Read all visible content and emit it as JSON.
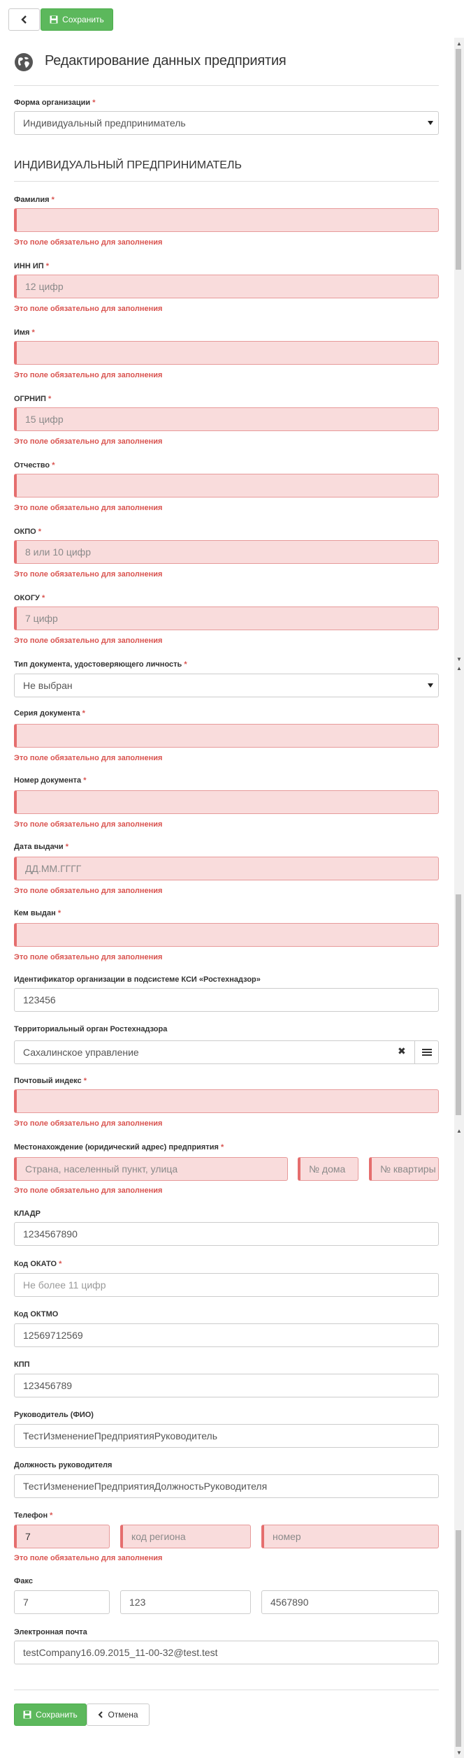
{
  "toolbar": {
    "save_label": "Сохранить"
  },
  "page": {
    "title": "Редактирование данных предприятия"
  },
  "org_form": {
    "label": "Форма организации",
    "value": "Индивидуальный предприниматель"
  },
  "section_title": "ИНДИВИДУАЛЬНЫЙ ПРЕДПРИНИМАТЕЛЬ",
  "required_error": "Это поле обязательно для заполнения",
  "fields": {
    "last_name": {
      "label": "Фамилия",
      "value": ""
    },
    "inn": {
      "label": "ИНН ИП",
      "placeholder": "12 цифр"
    },
    "first_name": {
      "label": "Имя",
      "value": ""
    },
    "ogrnip": {
      "label": "ОГРНИП",
      "placeholder": "15 цифр"
    },
    "patronymic": {
      "label": "Отчество",
      "value": ""
    },
    "okpo": {
      "label": "ОКПО",
      "placeholder": "8 или 10 цифр"
    },
    "okogu": {
      "label": "ОКОГУ",
      "placeholder": "7 цифр"
    },
    "doc_type": {
      "label": "Тип документа, удостоверяющего личность",
      "value": "Не выбран"
    },
    "doc_series": {
      "label": "Серия документа",
      "value": ""
    },
    "doc_number": {
      "label": "Номер документа",
      "value": ""
    },
    "issue_date": {
      "label": "Дата выдачи",
      "placeholder": "ДД.ММ.ГГГГ"
    },
    "issued_by": {
      "label": "Кем выдан",
      "value": ""
    },
    "ksi_id": {
      "label": "Идентификатор организации в подсистеме КСИ «Ростехнадзор»",
      "value": "123456"
    },
    "territorial_body": {
      "label": "Территориальный орган Ростехнадзора",
      "value": "Сахалинское управление"
    },
    "postal_code": {
      "label": "Почтовый индекс",
      "value": ""
    },
    "address": {
      "label": "Местонахождение (юридический адрес) предприятия",
      "placeholder_street": "Страна, населенный пункт, улица",
      "placeholder_house": "№ дома",
      "placeholder_flat": "№ квартиры"
    },
    "kladr": {
      "label": "КЛАДР",
      "value": "1234567890"
    },
    "okato": {
      "label": "Код ОКАТО",
      "placeholder": "Не более 11 цифр"
    },
    "oktmo": {
      "label": "Код ОКТМО",
      "value": "12569712569"
    },
    "kpp": {
      "label": "КПП",
      "value": "123456789"
    },
    "head": {
      "label": "Руководитель (ФИО)",
      "value": "ТестИзменениеПредприятияРуководитель"
    },
    "head_position": {
      "label": "Должность руководителя",
      "value": "ТестИзменениеПредприятияДолжностьРуководителя"
    },
    "phone": {
      "label": "Телефон",
      "country": "7",
      "placeholder_region": "код региона",
      "placeholder_number": "номер"
    },
    "fax": {
      "label": "Факс",
      "country": "7",
      "region": "123",
      "number": "4567890"
    },
    "email": {
      "label": "Электронная почта",
      "value": "testCompany16.09.2015_11-00-32@test.test"
    }
  },
  "footer": {
    "save_label": "Сохранить",
    "cancel_label": "Отмена"
  },
  "colors": {
    "success": "#5cb85c",
    "error": "#d9534f",
    "error_bg": "#f9dcdc"
  }
}
